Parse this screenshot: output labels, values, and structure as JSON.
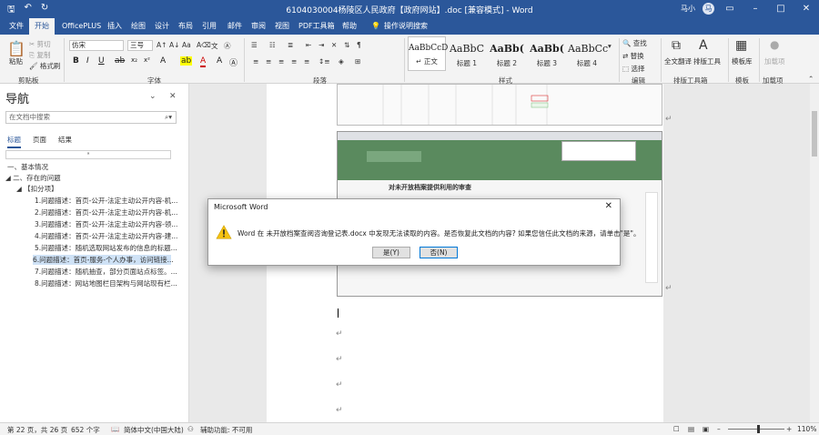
{
  "titlebar": {
    "title": "6104030004杨陵区人民政府【政府网站】.doc [兼容模式] - Word",
    "user": "马小",
    "avatar": "马"
  },
  "tabs": [
    "文件",
    "开始",
    "OfficePLUS",
    "插入",
    "绘图",
    "设计",
    "布局",
    "引用",
    "邮件",
    "审阅",
    "视图",
    "PDF工具箱",
    "帮助",
    "操作说明搜索"
  ],
  "ribbon": {
    "clipboard": {
      "paste": "粘贴",
      "cut": "剪切",
      "copy": "复制",
      "format_painter": "格式刷",
      "label": "剪贴板"
    },
    "font": {
      "name": "仿宋",
      "size": "三号",
      "label": "字体"
    },
    "paragraph": {
      "label": "段落"
    },
    "styles": {
      "items": [
        "AaBbCcD",
        "AaBbC",
        "AaBb(",
        "AaBb(",
        "AaBbCc"
      ],
      "names": [
        "正文",
        "标题 1",
        "标题 2",
        "标题 3",
        "标题 4"
      ],
      "label": "样式"
    },
    "editing": {
      "find": "查找",
      "replace": "替换",
      "select": "选择",
      "label": "编辑"
    },
    "pdf": {
      "full": "全文翻译",
      "layout": "排版工具",
      "label": "排版工具箱"
    },
    "template": {
      "label": "模板库",
      "group": "模板"
    },
    "addins": {
      "label": "加载项",
      "group": "加载项"
    }
  },
  "nav": {
    "title": "导航",
    "search_placeholder": "在文档中搜索",
    "tabs": [
      "标题",
      "页面",
      "结果"
    ],
    "headings": [
      "一、基本情况",
      "二、存在的问题",
      "【扣分项】",
      "1.问题描述：首页-公开-法定主动公开内容-机...",
      "2.问题描述：首页-公开-法定主动公开内容-机...",
      "3.问题描述：首页-公开-法定主动公开内容-领...",
      "4.问题描述：首页-公开-法定主动公开内容-建...",
      "5.问题描述：随机选取网站发布的信息的标题...",
      "6.问题描述：首页-服务-个人办事，访问链接...",
      "7.问题描述：随机抽查，部分页面站点标签。...",
      "8.问题描述：网站地图栏目架构与网站现有栏..."
    ]
  },
  "document": {
    "screenshot_title": "对未开放档案提供利用的审查"
  },
  "dialog": {
    "title": "Microsoft Word",
    "message": "Word 在 未开放档案查阅咨询登记表.docx 中发现无法读取的内容。是否恢复此文档的内容? 如果您信任此文档的来源，请单击\"是\"。",
    "yes": "是(Y)",
    "no": "否(N)"
  },
  "status": {
    "page": "第 22 页，共 26 页",
    "words": "652 个字",
    "lang": "简体中文(中国大陆)",
    "access": "辅助功能: 不可用",
    "zoom": "110%"
  }
}
